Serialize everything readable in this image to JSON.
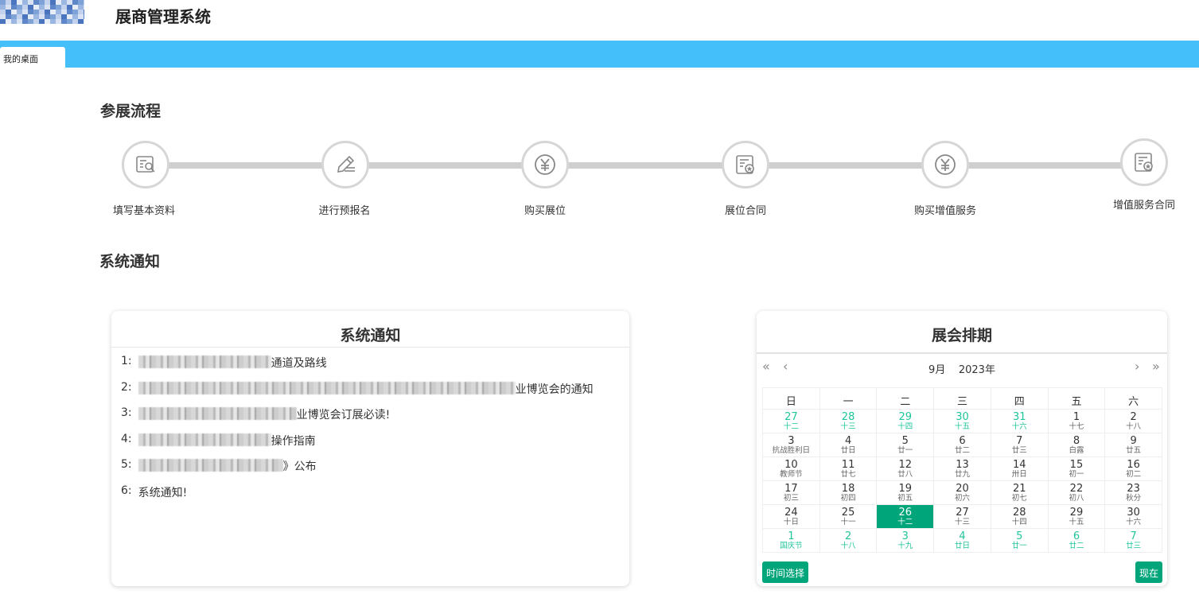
{
  "header": {
    "title": "展商管理系统"
  },
  "tabs": [
    {
      "label": "我的桌面"
    }
  ],
  "process": {
    "title": "参展流程",
    "steps": [
      {
        "label": "填写基本资料",
        "icon": "certificate-search-icon"
      },
      {
        "label": "进行预报名",
        "icon": "pen-edit-icon"
      },
      {
        "label": "购买展位",
        "icon": "yuan-icon"
      },
      {
        "label": "展位合同",
        "icon": "contract-icon"
      },
      {
        "label": "购买增值服务",
        "icon": "yuan-icon"
      },
      {
        "label": "增值服务合同",
        "icon": "contract-icon"
      }
    ]
  },
  "notice_section": {
    "title": "系统通知"
  },
  "notice_card": {
    "title": "系统通知",
    "items": [
      {
        "num": "1:",
        "text": "通道及路线"
      },
      {
        "num": "2:",
        "text": "业博览会的通知"
      },
      {
        "num": "3:",
        "text": "业博览会订展必读!"
      },
      {
        "num": "4:",
        "text": "操作指南"
      },
      {
        "num": "5:",
        "text": "》公布"
      },
      {
        "num": "6:",
        "text": "系统通知!"
      }
    ]
  },
  "calendar": {
    "title": "展会排期",
    "month": "9月",
    "year": "2023年",
    "weekdays": [
      "日",
      "一",
      "二",
      "三",
      "四",
      "五",
      "六"
    ],
    "weeks": [
      [
        {
          "d": "27",
          "l": "十二",
          "other": true
        },
        {
          "d": "28",
          "l": "十三",
          "other": true
        },
        {
          "d": "29",
          "l": "十四",
          "other": true
        },
        {
          "d": "30",
          "l": "十五",
          "other": true
        },
        {
          "d": "31",
          "l": "十六",
          "other": true
        },
        {
          "d": "1",
          "l": "十七"
        },
        {
          "d": "2",
          "l": "十八"
        }
      ],
      [
        {
          "d": "3",
          "l": "抗战胜利日"
        },
        {
          "d": "4",
          "l": "廿日"
        },
        {
          "d": "5",
          "l": "廿一"
        },
        {
          "d": "6",
          "l": "廿二"
        },
        {
          "d": "7",
          "l": "廿三"
        },
        {
          "d": "8",
          "l": "白露"
        },
        {
          "d": "9",
          "l": "廿五"
        }
      ],
      [
        {
          "d": "10",
          "l": "教师节"
        },
        {
          "d": "11",
          "l": "廿七"
        },
        {
          "d": "12",
          "l": "廿八"
        },
        {
          "d": "13",
          "l": "廿九"
        },
        {
          "d": "14",
          "l": "卅日"
        },
        {
          "d": "15",
          "l": "初一"
        },
        {
          "d": "16",
          "l": "初二"
        }
      ],
      [
        {
          "d": "17",
          "l": "初三"
        },
        {
          "d": "18",
          "l": "初四"
        },
        {
          "d": "19",
          "l": "初五"
        },
        {
          "d": "20",
          "l": "初六"
        },
        {
          "d": "21",
          "l": "初七"
        },
        {
          "d": "22",
          "l": "初八"
        },
        {
          "d": "23",
          "l": "秋分"
        }
      ],
      [
        {
          "d": "24",
          "l": "十日"
        },
        {
          "d": "25",
          "l": "十一"
        },
        {
          "d": "26",
          "l": "十二",
          "selected": true
        },
        {
          "d": "27",
          "l": "十三"
        },
        {
          "d": "28",
          "l": "十四"
        },
        {
          "d": "29",
          "l": "十五"
        },
        {
          "d": "30",
          "l": "十六"
        }
      ],
      [
        {
          "d": "1",
          "l": "国庆节",
          "other": true
        },
        {
          "d": "2",
          "l": "十八",
          "other": true
        },
        {
          "d": "3",
          "l": "十九",
          "other": true
        },
        {
          "d": "4",
          "l": "廿日",
          "other": true
        },
        {
          "d": "5",
          "l": "廿一",
          "other": true
        },
        {
          "d": "6",
          "l": "廿二",
          "other": true
        },
        {
          "d": "7",
          "l": "廿三",
          "other": true
        }
      ]
    ],
    "time_select_label": "时间选择",
    "now_label": "现在"
  },
  "colors": {
    "tabbar": "#44bff9",
    "accent": "#00a57a",
    "other_month": "#1fc59b"
  }
}
